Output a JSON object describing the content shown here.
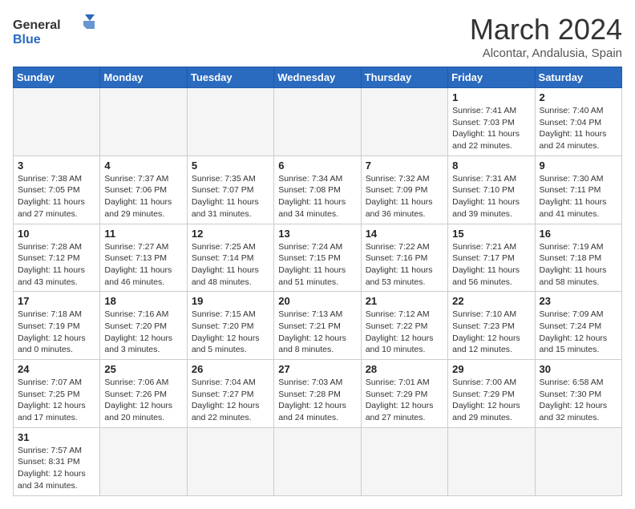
{
  "header": {
    "logo_general": "General",
    "logo_blue": "Blue",
    "month_title": "March 2024",
    "subtitle": "Alcontar, Andalusia, Spain"
  },
  "weekdays": [
    "Sunday",
    "Monday",
    "Tuesday",
    "Wednesday",
    "Thursday",
    "Friday",
    "Saturday"
  ],
  "weeks": [
    [
      {
        "day": "",
        "info": ""
      },
      {
        "day": "",
        "info": ""
      },
      {
        "day": "",
        "info": ""
      },
      {
        "day": "",
        "info": ""
      },
      {
        "day": "",
        "info": ""
      },
      {
        "day": "1",
        "info": "Sunrise: 7:41 AM\nSunset: 7:03 PM\nDaylight: 11 hours\nand 22 minutes."
      },
      {
        "day": "2",
        "info": "Sunrise: 7:40 AM\nSunset: 7:04 PM\nDaylight: 11 hours\nand 24 minutes."
      }
    ],
    [
      {
        "day": "3",
        "info": "Sunrise: 7:38 AM\nSunset: 7:05 PM\nDaylight: 11 hours\nand 27 minutes."
      },
      {
        "day": "4",
        "info": "Sunrise: 7:37 AM\nSunset: 7:06 PM\nDaylight: 11 hours\nand 29 minutes."
      },
      {
        "day": "5",
        "info": "Sunrise: 7:35 AM\nSunset: 7:07 PM\nDaylight: 11 hours\nand 31 minutes."
      },
      {
        "day": "6",
        "info": "Sunrise: 7:34 AM\nSunset: 7:08 PM\nDaylight: 11 hours\nand 34 minutes."
      },
      {
        "day": "7",
        "info": "Sunrise: 7:32 AM\nSunset: 7:09 PM\nDaylight: 11 hours\nand 36 minutes."
      },
      {
        "day": "8",
        "info": "Sunrise: 7:31 AM\nSunset: 7:10 PM\nDaylight: 11 hours\nand 39 minutes."
      },
      {
        "day": "9",
        "info": "Sunrise: 7:30 AM\nSunset: 7:11 PM\nDaylight: 11 hours\nand 41 minutes."
      }
    ],
    [
      {
        "day": "10",
        "info": "Sunrise: 7:28 AM\nSunset: 7:12 PM\nDaylight: 11 hours\nand 43 minutes."
      },
      {
        "day": "11",
        "info": "Sunrise: 7:27 AM\nSunset: 7:13 PM\nDaylight: 11 hours\nand 46 minutes."
      },
      {
        "day": "12",
        "info": "Sunrise: 7:25 AM\nSunset: 7:14 PM\nDaylight: 11 hours\nand 48 minutes."
      },
      {
        "day": "13",
        "info": "Sunrise: 7:24 AM\nSunset: 7:15 PM\nDaylight: 11 hours\nand 51 minutes."
      },
      {
        "day": "14",
        "info": "Sunrise: 7:22 AM\nSunset: 7:16 PM\nDaylight: 11 hours\nand 53 minutes."
      },
      {
        "day": "15",
        "info": "Sunrise: 7:21 AM\nSunset: 7:17 PM\nDaylight: 11 hours\nand 56 minutes."
      },
      {
        "day": "16",
        "info": "Sunrise: 7:19 AM\nSunset: 7:18 PM\nDaylight: 11 hours\nand 58 minutes."
      }
    ],
    [
      {
        "day": "17",
        "info": "Sunrise: 7:18 AM\nSunset: 7:19 PM\nDaylight: 12 hours\nand 0 minutes."
      },
      {
        "day": "18",
        "info": "Sunrise: 7:16 AM\nSunset: 7:20 PM\nDaylight: 12 hours\nand 3 minutes."
      },
      {
        "day": "19",
        "info": "Sunrise: 7:15 AM\nSunset: 7:20 PM\nDaylight: 12 hours\nand 5 minutes."
      },
      {
        "day": "20",
        "info": "Sunrise: 7:13 AM\nSunset: 7:21 PM\nDaylight: 12 hours\nand 8 minutes."
      },
      {
        "day": "21",
        "info": "Sunrise: 7:12 AM\nSunset: 7:22 PM\nDaylight: 12 hours\nand 10 minutes."
      },
      {
        "day": "22",
        "info": "Sunrise: 7:10 AM\nSunset: 7:23 PM\nDaylight: 12 hours\nand 12 minutes."
      },
      {
        "day": "23",
        "info": "Sunrise: 7:09 AM\nSunset: 7:24 PM\nDaylight: 12 hours\nand 15 minutes."
      }
    ],
    [
      {
        "day": "24",
        "info": "Sunrise: 7:07 AM\nSunset: 7:25 PM\nDaylight: 12 hours\nand 17 minutes."
      },
      {
        "day": "25",
        "info": "Sunrise: 7:06 AM\nSunset: 7:26 PM\nDaylight: 12 hours\nand 20 minutes."
      },
      {
        "day": "26",
        "info": "Sunrise: 7:04 AM\nSunset: 7:27 PM\nDaylight: 12 hours\nand 22 minutes."
      },
      {
        "day": "27",
        "info": "Sunrise: 7:03 AM\nSunset: 7:28 PM\nDaylight: 12 hours\nand 24 minutes."
      },
      {
        "day": "28",
        "info": "Sunrise: 7:01 AM\nSunset: 7:29 PM\nDaylight: 12 hours\nand 27 minutes."
      },
      {
        "day": "29",
        "info": "Sunrise: 7:00 AM\nSunset: 7:29 PM\nDaylight: 12 hours\nand 29 minutes."
      },
      {
        "day": "30",
        "info": "Sunrise: 6:58 AM\nSunset: 7:30 PM\nDaylight: 12 hours\nand 32 minutes."
      }
    ],
    [
      {
        "day": "31",
        "info": "Sunrise: 7:57 AM\nSunset: 8:31 PM\nDaylight: 12 hours\nand 34 minutes."
      },
      {
        "day": "",
        "info": ""
      },
      {
        "day": "",
        "info": ""
      },
      {
        "day": "",
        "info": ""
      },
      {
        "day": "",
        "info": ""
      },
      {
        "day": "",
        "info": ""
      },
      {
        "day": "",
        "info": ""
      }
    ]
  ]
}
